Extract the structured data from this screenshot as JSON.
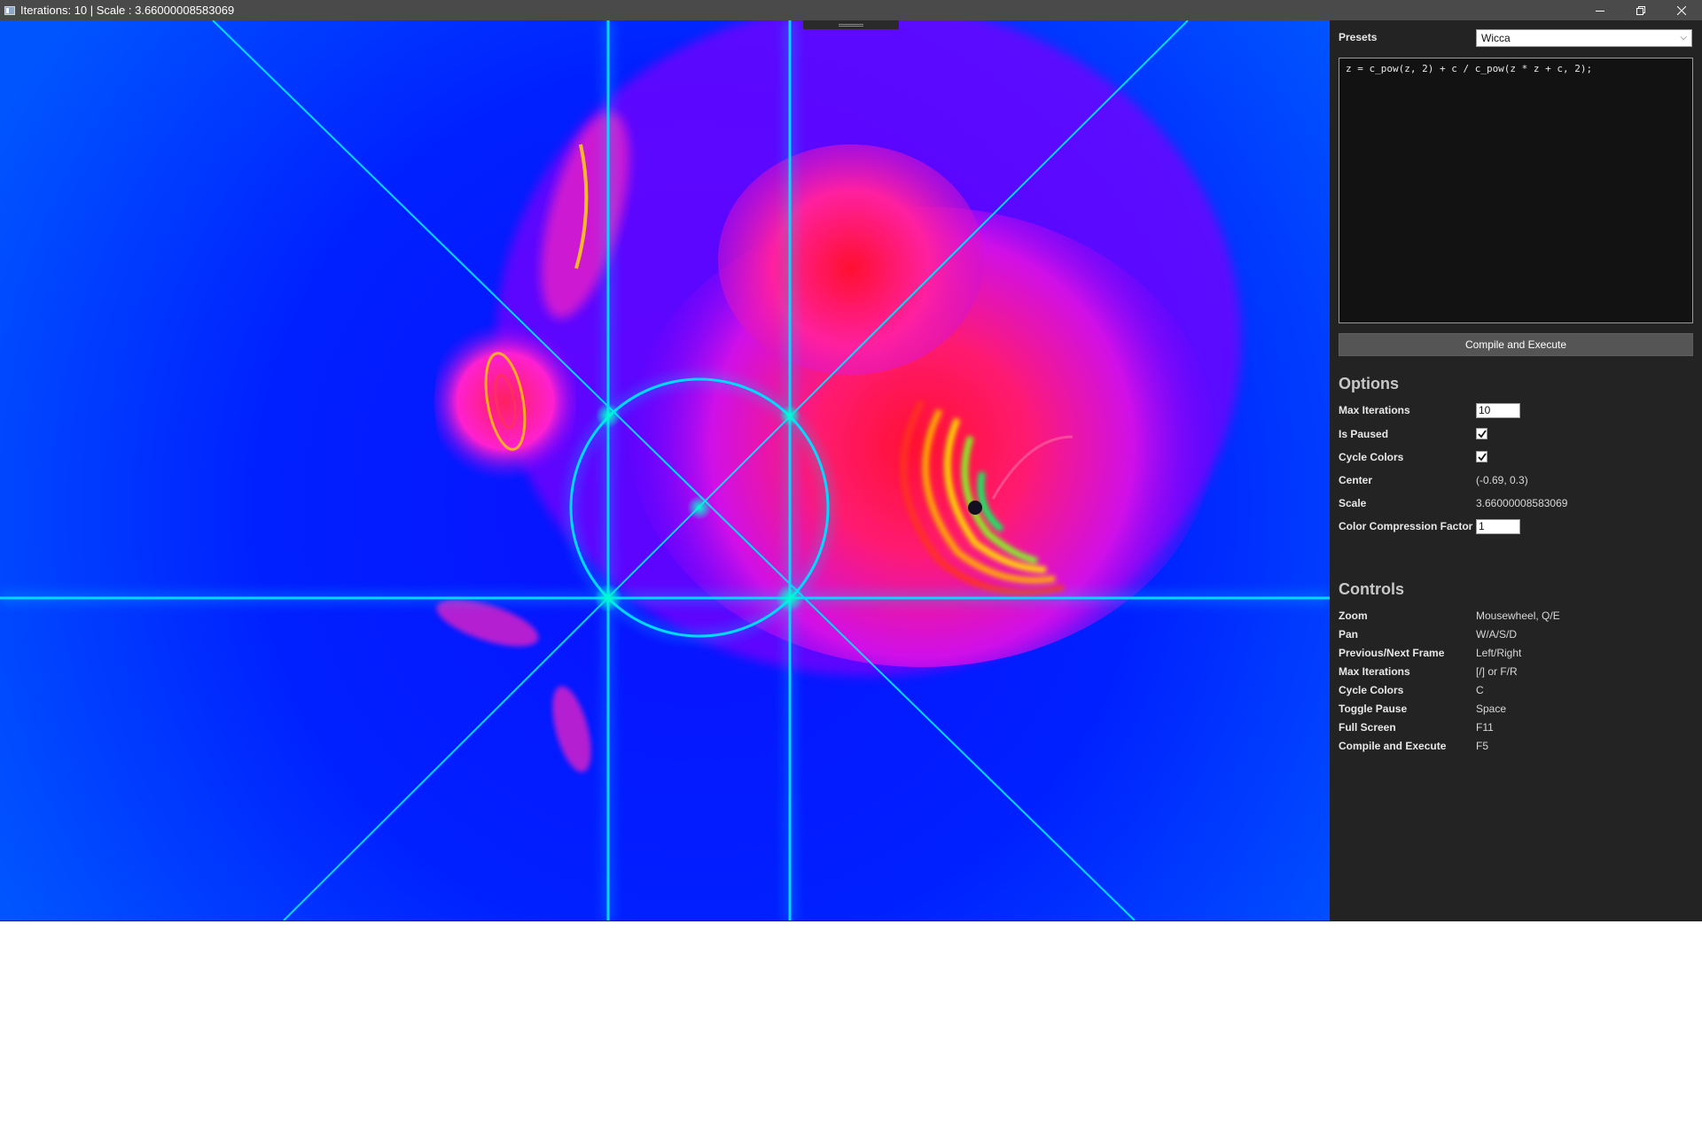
{
  "window": {
    "title": "Iterations: 10 | Scale : 3.66000008583069",
    "controls": [
      "minimize",
      "restore",
      "close"
    ]
  },
  "panel": {
    "presets": {
      "label": "Presets",
      "selected": "Wicca"
    },
    "code": "z = c_pow(z, 2) + c / c_pow(z * z + c, 2);",
    "compile_button": "Compile and Execute",
    "options": {
      "title": "Options",
      "rows": [
        {
          "label": "Max Iterations",
          "kind": "input",
          "value": "10"
        },
        {
          "label": "Is Paused",
          "kind": "checkbox",
          "checked": true
        },
        {
          "label": "Cycle Colors",
          "kind": "checkbox",
          "checked": true
        },
        {
          "label": "Center",
          "kind": "text",
          "value": "(-0.69, 0.3)"
        },
        {
          "label": "Scale",
          "kind": "text",
          "value": "3.66000008583069"
        },
        {
          "label": "Color Compression Factor",
          "kind": "input",
          "value": "1"
        }
      ]
    },
    "controls": {
      "title": "Controls",
      "rows": [
        {
          "action": "Zoom",
          "keys": "Mousewheel, Q/E"
        },
        {
          "action": "Pan",
          "keys": "W/A/S/D"
        },
        {
          "action": "Previous/Next Frame",
          "keys": "Left/Right"
        },
        {
          "action": "Max Iterations",
          "keys": "[/] or F/R"
        },
        {
          "action": "Cycle Colors",
          "keys": "C"
        },
        {
          "action": "Toggle Pause",
          "keys": "Space"
        },
        {
          "action": "Full Screen",
          "keys": "F11"
        },
        {
          "action": "Compile and Execute",
          "keys": "F5"
        }
      ]
    }
  },
  "colors": {
    "titlebar": "#4a4a4a",
    "panel_bg": "#232323",
    "fractal_bg": "#0a14ff",
    "fractal_lines": "#00e5ff",
    "fractal_hot": "#ff1a6b"
  }
}
